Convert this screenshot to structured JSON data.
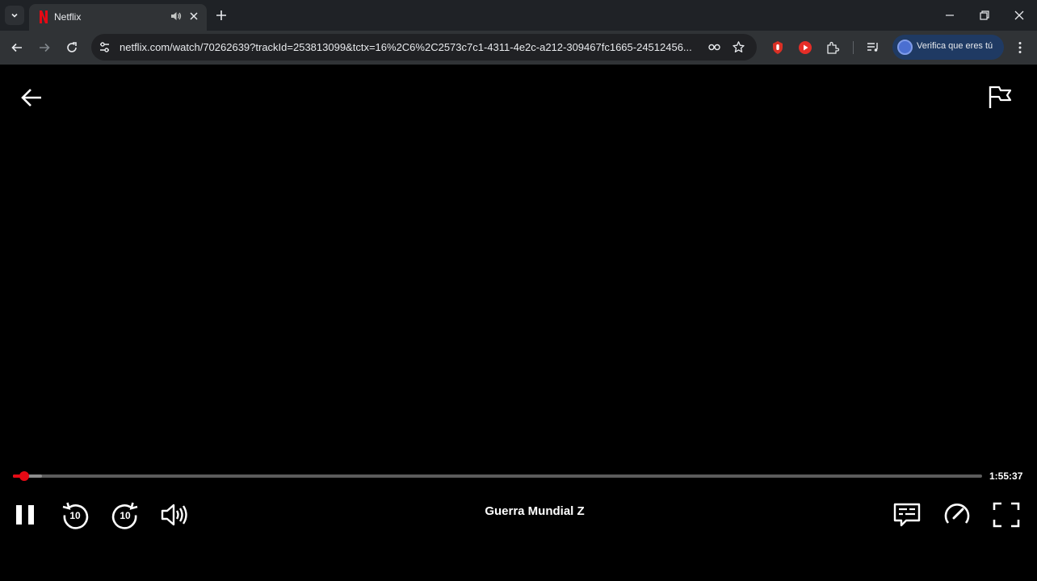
{
  "browser": {
    "tab": {
      "title": "Netflix"
    },
    "address_bar": {
      "url": "netflix.com/watch/70262639?trackId=253813099&tctx=16%2C6%2C2573c7c1-4311-4e2c-a212-309467fc1665-24512456..."
    },
    "profile": {
      "label": "Verifica que eres tú"
    },
    "colors": {
      "tabbar_bg": "#1f2226",
      "toolbar_bg": "#303336",
      "omnibox_bg": "#202124",
      "profile_bg": "#1f3a63"
    }
  },
  "player": {
    "title": "Guerra Mundial Z",
    "time_remaining": "1:55:37",
    "progress": {
      "played_fraction": 0.012,
      "buffered_fraction": 0.03
    },
    "colors": {
      "accent": "#e50914",
      "background": "#000000"
    },
    "icons": [
      "back-arrow-icon",
      "report-flag-icon",
      "pause-icon",
      "rewind-10-icon",
      "forward-10-icon",
      "volume-icon",
      "subtitles-icon",
      "playback-speed-icon",
      "fullscreen-icon"
    ]
  }
}
